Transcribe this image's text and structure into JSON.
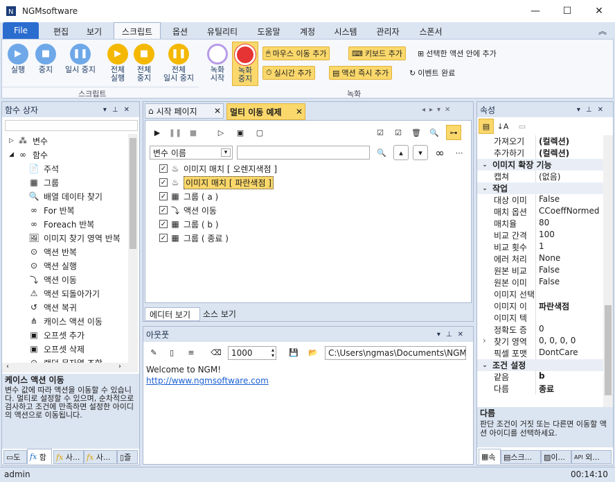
{
  "app": {
    "title": "NGMsoftware"
  },
  "menu_tabs": [
    "File",
    "편집",
    "보기",
    "스크립트",
    "옵션",
    "유틸리티",
    "도움말",
    "계정",
    "시스템",
    "관리자",
    "스폰서"
  ],
  "ribbon": {
    "script_group": "스크립트",
    "record_group": "녹화",
    "buttons": {
      "run": "실행",
      "stop": "중지",
      "pause": "일시 중지",
      "run_all_1": "전체",
      "run_all_2": "실행",
      "stop_all_1": "전체",
      "stop_all_2": "중지",
      "pause_all_1": "전체",
      "pause_all_2": "일시 중지",
      "rec_start_1": "녹화",
      "rec_start_2": "시작",
      "rec_stop_1": "녹화",
      "rec_stop_2": "중지"
    },
    "small": {
      "mouse": "마우스 이동 추가",
      "keyboard": "키보드 추가",
      "in_selected": "선택한 액션 안에 추가",
      "realtime": "실시간 추가",
      "immediate": "액션 즉시 추가",
      "event_done": "이벤트 완료"
    }
  },
  "left_panel": {
    "title": "함수 상자",
    "tree": [
      {
        "label": "변수",
        "level": 0,
        "expand": "▷"
      },
      {
        "label": "함수",
        "level": 0,
        "expand": "◢"
      },
      {
        "label": "주석",
        "level": 1
      },
      {
        "label": "그룹",
        "level": 1
      },
      {
        "label": "배열 데이타 찾기",
        "level": 1
      },
      {
        "label": "For 반복",
        "level": 1
      },
      {
        "label": "Foreach 반복",
        "level": 1
      },
      {
        "label": "이미지 찾기 영역 반복",
        "level": 1
      },
      {
        "label": "액션 반복",
        "level": 1
      },
      {
        "label": "액션 실행",
        "level": 1
      },
      {
        "label": "액션 이동",
        "level": 1
      },
      {
        "label": "액션 되돌아가기",
        "level": 1
      },
      {
        "label": "액션 복귀",
        "level": 1
      },
      {
        "label": "캐이스 액션 이동",
        "level": 1
      },
      {
        "label": "오프셋 추가",
        "level": 1
      },
      {
        "label": "오프셋 삭제",
        "level": 1
      },
      {
        "label": "랜덤 문자열 조합",
        "level": 1
      }
    ],
    "desc_title": "케이스 액션 이동",
    "desc_text": "변수 값에 따라 액션을 이동할 수 있습니다. 멀티로 설정할 수 있으며, 순차적으로 검사하고 조건에 만족하면 설정한 아이디의 액션으로 이동됩니다.",
    "bottom_tabs": [
      "도",
      "함",
      "사...",
      "사...",
      "즐"
    ]
  },
  "doc_tabs": [
    "시작 페이지",
    "멀티 이동 예제"
  ],
  "editor": {
    "search_select": "변수 이름",
    "actions": [
      {
        "label": "이미지 매치 [ 오렌지색점 ]",
        "selected": false
      },
      {
        "label": "이미지 매치 [ 파란색점 ]",
        "selected": true
      },
      {
        "label": "그룹 ( a )",
        "selected": false
      },
      {
        "label": "액션 이동",
        "selected": false
      },
      {
        "label": "그룹 ( b )",
        "selected": false
      },
      {
        "label": "그룹 ( 종료 )",
        "selected": false
      }
    ],
    "view_tabs": [
      "에디터 보기",
      "소스 보기"
    ]
  },
  "output": {
    "title": "아웃풋",
    "count": "1000",
    "path": "C:\\Users\\ngmas\\Documents\\NGM6\\",
    "lines": [
      "Welcome to NGM!",
      "http://www.ngmsoftware.com"
    ]
  },
  "props": {
    "title": "속성",
    "rows": [
      {
        "t": "row",
        "k": "가져오기",
        "v": "(컬렉션)",
        "bold": true
      },
      {
        "t": "row",
        "k": "추가하기",
        "v": "(컬렉션)",
        "bold": true
      },
      {
        "t": "cat",
        "k": "이미지 확장 기능"
      },
      {
        "t": "row",
        "k": "캡쳐",
        "v": "(없음)"
      },
      {
        "t": "cat",
        "k": "작업"
      },
      {
        "t": "row",
        "k": "대상 이미",
        "v": "False"
      },
      {
        "t": "row",
        "k": "매치 옵션",
        "v": "CCoeffNormed"
      },
      {
        "t": "row",
        "k": "매치율",
        "v": "80"
      },
      {
        "t": "row",
        "k": "비교 간격",
        "v": "100"
      },
      {
        "t": "row",
        "k": "비교 횟수",
        "v": "1"
      },
      {
        "t": "row",
        "k": "에러 처리",
        "v": "None"
      },
      {
        "t": "row",
        "k": "원본 비교",
        "v": "False"
      },
      {
        "t": "row",
        "k": "원본 이미",
        "v": "False"
      },
      {
        "t": "row",
        "k": "이미지 선택",
        "v": ""
      },
      {
        "t": "row",
        "k": "이미지 이",
        "v": "파란색점",
        "bold": true
      },
      {
        "t": "row",
        "k": "이미지 텍",
        "v": ""
      },
      {
        "t": "row",
        "k": "정확도 증",
        "v": "0"
      },
      {
        "t": "row",
        "k": "찾기 영역",
        "v": "0, 0, 0, 0",
        "exp": true
      },
      {
        "t": "row",
        "k": "픽셀 포맷",
        "v": "DontCare"
      },
      {
        "t": "cat",
        "k": "조건 설정"
      },
      {
        "t": "row",
        "k": "같음",
        "v": "b",
        "bold": true
      },
      {
        "t": "row",
        "k": "다름",
        "v": "종료",
        "bold": true
      }
    ],
    "desc_title": "다름",
    "desc_text": "판단 조건이 거짓 또는 다른면 이동할 액션 아이디를 선택하세요.",
    "bottom_tabs": [
      "속",
      "스크...",
      "이...",
      "외..."
    ]
  },
  "status": {
    "user": "admin",
    "time": "00:14:10"
  }
}
